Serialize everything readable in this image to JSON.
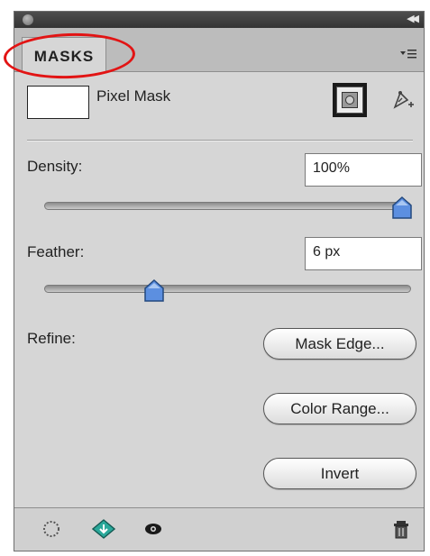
{
  "panel": {
    "tab_label": "MASKS",
    "mask_type_label": "Pixel Mask"
  },
  "density": {
    "label": "Density:",
    "value": "100%",
    "slider_fraction": 1.0
  },
  "feather": {
    "label": "Feather:",
    "value": "6 px",
    "slider_fraction": 0.3
  },
  "refine": {
    "label": "Refine:",
    "mask_edge_button": "Mask Edge...",
    "color_range_button": "Color Range...",
    "invert_button": "Invert"
  },
  "icons": {
    "titlebar": [
      "close-icon",
      "collapse-panel-icon"
    ],
    "tab": [
      "panel-menu-icon"
    ],
    "mask": [
      "pixel-mask-icon",
      "vector-mask-icon"
    ],
    "bottom": [
      "load-selection-icon",
      "apply-mask-icon",
      "visibility-eye-icon",
      "delete-mask-icon"
    ]
  },
  "colors": {
    "highlight_ring": "#e21414",
    "slider_thumb": "#5c8fe0"
  }
}
